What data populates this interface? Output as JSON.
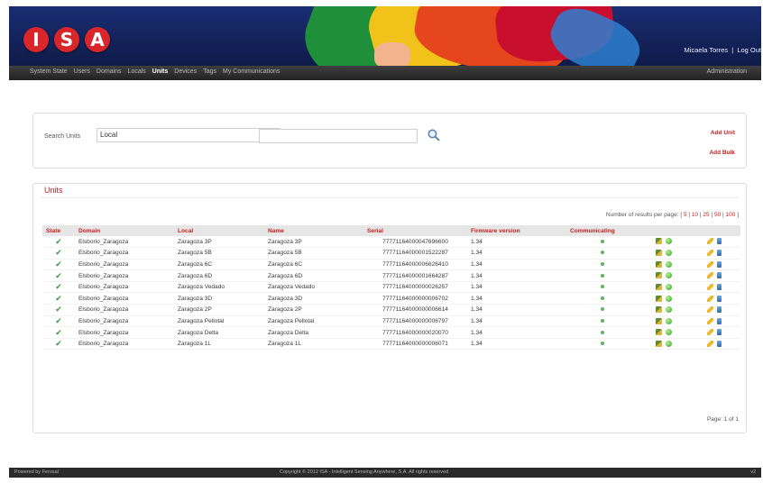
{
  "brand": {
    "logo_letters": [
      "I",
      "S",
      "A"
    ]
  },
  "header": {
    "user_name": "Micaela Torres",
    "separator": "|",
    "logout_label": "Log Out"
  },
  "nav": {
    "items": [
      "System State",
      "Users",
      "Domains",
      "Locals",
      "Units",
      "Devices",
      "Tags",
      "My Communications"
    ],
    "active": "Units",
    "admin_label": "Administration"
  },
  "search": {
    "label": "Search Units",
    "select_value": "Local",
    "select_arrow": "▾",
    "input_value": "",
    "search_icon": "magnifier-icon"
  },
  "actions": {
    "add_unit": "Add Unit",
    "add_bulk": "Add Bulk"
  },
  "units": {
    "title": "Units",
    "per_page_label": "Number of results per page:",
    "per_page_options": [
      "5",
      "10",
      "25",
      "50",
      "100"
    ],
    "columns": [
      "State",
      "Domain",
      "Local",
      "Name",
      "Serial",
      "Firmware version",
      "Communicating"
    ],
    "rows": [
      {
        "domain": "Elsborio_Zaragoza",
        "local": "Zaragoza 3P",
        "name": "Zaragoza 3P",
        "serial": "77771164000047696600",
        "firmware": "1.34"
      },
      {
        "domain": "Elsborio_Zaragoza",
        "local": "Zaragoza 5B",
        "name": "Zaragoza 5B",
        "serial": "77771164000001522287",
        "firmware": "1.34"
      },
      {
        "domain": "Elsborio_Zaragoza",
        "local": "Zaragoza 6C",
        "name": "Zaragoza 6C",
        "serial": "77771164000006626410",
        "firmware": "1.34"
      },
      {
        "domain": "Elsborio_Zaragoza",
        "local": "Zaragoza 6D",
        "name": "Zaragoza 6D",
        "serial": "77771164000001664287",
        "firmware": "1.34"
      },
      {
        "domain": "Elsborio_Zaragoza",
        "local": "Zaragoza Vedado",
        "name": "Zaragoza Vedado",
        "serial": "77771164000000026257",
        "firmware": "1.34"
      },
      {
        "domain": "Elsborio_Zaragoza",
        "local": "Zaragoza 3D",
        "name": "Zaragoza 3D",
        "serial": "77771164000000006702",
        "firmware": "1.34"
      },
      {
        "domain": "Elsborio_Zaragoza",
        "local": "Zaragoza 2P",
        "name": "Zaragoza 2P",
        "serial": "77771164000000006614",
        "firmware": "1.34"
      },
      {
        "domain": "Elsborio_Zaragoza",
        "local": "Zaragoza Pellotal",
        "name": "Zaragoza Pellotal",
        "serial": "77771164000000006797",
        "firmware": "1.34"
      },
      {
        "domain": "Elsborio_Zaragoza",
        "local": "Zaragoza Delta",
        "name": "Zaragoza Delta",
        "serial": "77771164000000020070",
        "firmware": "1.34"
      },
      {
        "domain": "Elsborio_Zaragoza",
        "local": "Zaragoza 1L",
        "name": "Zaragoza 1L",
        "serial": "77771164000000006071",
        "firmware": "1.34"
      }
    ],
    "paging": "Page: 1 of 1"
  },
  "footer": {
    "left": "Powered by Ferosal",
    "center": "Copyright © 2012 ISA - Intelligent Sensing Anywhere, S.A. All rights reserved",
    "right": "v2"
  },
  "colors": {
    "accent": "#c32020",
    "banner": "#1a2e74",
    "ok": "#3c9a3c"
  }
}
